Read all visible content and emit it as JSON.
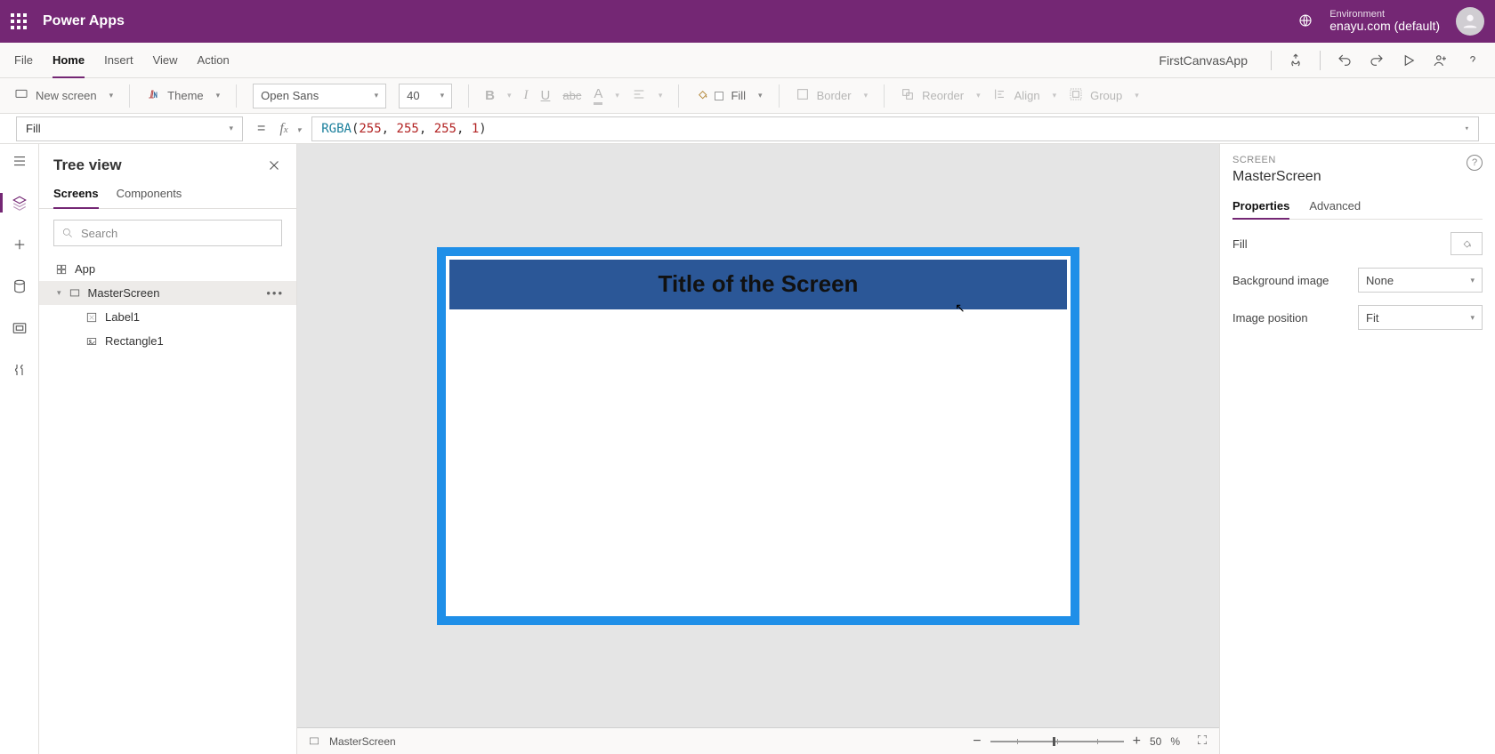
{
  "topbar": {
    "app_name": "Power Apps",
    "env_label": "Environment",
    "env_name": "enayu.com (default)"
  },
  "menubar": {
    "tabs": [
      "File",
      "Home",
      "Insert",
      "View",
      "Action"
    ],
    "active_tab": "Home",
    "app_display_name": "FirstCanvasApp"
  },
  "ribbon": {
    "new_screen": "New screen",
    "theme": "Theme",
    "font_family": "Open Sans",
    "font_size": "40",
    "fill": "Fill",
    "border": "Border",
    "reorder": "Reorder",
    "align": "Align",
    "group": "Group"
  },
  "formula": {
    "property": "Fill",
    "fn": "RGBA",
    "args": [
      "255",
      "255",
      "255",
      "1"
    ]
  },
  "tree": {
    "title": "Tree view",
    "tabs": [
      "Screens",
      "Components"
    ],
    "active_tab": "Screens",
    "search_placeholder": "Search",
    "nodes": {
      "app": "App",
      "screen": "MasterScreen",
      "children": [
        "Label1",
        "Rectangle1"
      ]
    }
  },
  "canvas": {
    "title_label": "Title of the Screen"
  },
  "statusbar": {
    "screen_name": "MasterScreen",
    "zoom": "50",
    "zoom_unit": "%"
  },
  "props": {
    "type_label": "SCREEN",
    "name": "MasterScreen",
    "tabs": [
      "Properties",
      "Advanced"
    ],
    "active_tab": "Properties",
    "rows": {
      "fill_label": "Fill",
      "bg_label": "Background image",
      "bg_value": "None",
      "imgpos_label": "Image position",
      "imgpos_value": "Fit"
    }
  }
}
